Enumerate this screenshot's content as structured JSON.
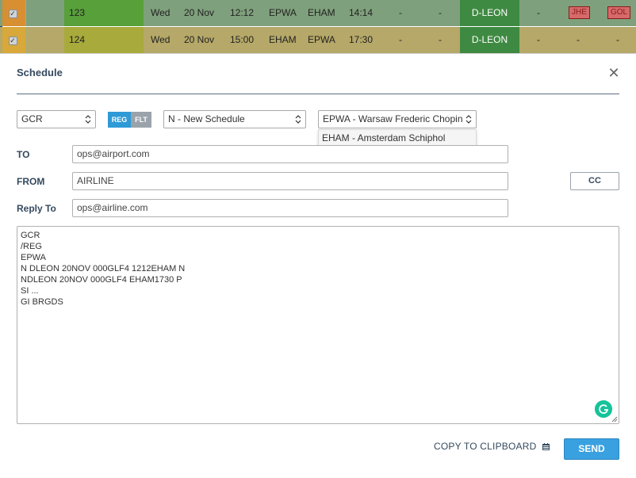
{
  "rows": [
    {
      "id": "123",
      "day": "Wed",
      "date": "20 Nov",
      "std": "12:12",
      "adep": "EPWA",
      "ades": "EHAM",
      "sta": "14:14",
      "d1": "-",
      "d2": "-",
      "reg": "D-LEON",
      "d3": "-",
      "tag1": "JHE",
      "tag2": "GOL"
    },
    {
      "id": "124",
      "day": "Wed",
      "date": "20 Nov",
      "std": "15:00",
      "adep": "EHAM",
      "ades": "EPWA",
      "sta": "17:30",
      "d1": "-",
      "d2": "-",
      "reg": "D-LEON",
      "d3": "-",
      "d4": "-",
      "d5": "-"
    }
  ],
  "modal": {
    "title": "Schedule",
    "close_icon": "close-icon",
    "message_type": "GCR",
    "toggle": {
      "reg": "REG",
      "flt": "FLT",
      "selected": "REG"
    },
    "action": "N - New Schedule",
    "airport": "EPWA - Warsaw Frederic Chopin",
    "airport_dropdown_option": "EHAM - Amsterdam Schiphol",
    "to_label": "TO",
    "to_value": "ops@airport.com",
    "from_label": "FROM",
    "from_value": "AIRLINE",
    "reply_label": "Reply To",
    "reply_value": "ops@airline.com",
    "cc_label": "CC",
    "message": "GCR\n/REG\nEPWA\nN DLEON 20NOV 000GLF4 1212EHAM N\nNDLEON 20NOV 000GLF4 EHAM1730 P\nSI ...\nGI BRGDS",
    "copy_label": "COPY TO CLIPBOARD",
    "send_label": "SEND"
  },
  "colors": {
    "accent": "#3aa1e0",
    "title": "#34495e",
    "row1_bg": "#7fa07c",
    "row2_bg": "#b5a868"
  }
}
